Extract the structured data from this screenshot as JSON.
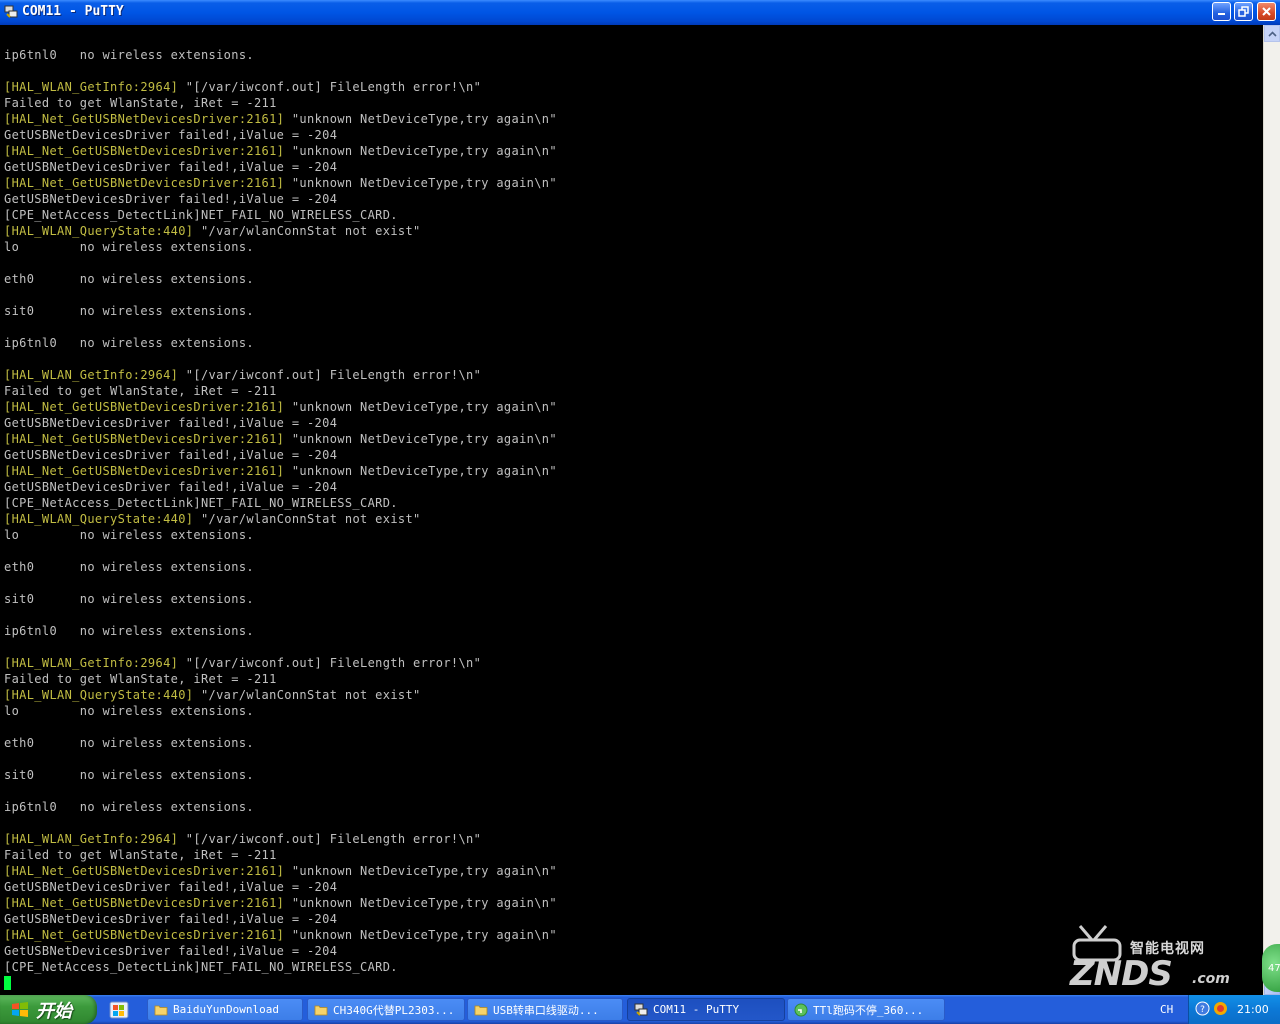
{
  "window": {
    "title": "COM11 - PuTTY"
  },
  "terminal": {
    "lines": [
      {
        "tag": "",
        "text": "ip6tnl0   no wireless extensions."
      },
      {
        "tag": "",
        "text": ""
      },
      {
        "tag": "[HAL_WLAN_GetInfo:2964]",
        "text": " \"[/var/iwconf.out] FileLength error!\\n\""
      },
      {
        "tag": "",
        "text": "Failed to get WlanState, iRet = -211"
      },
      {
        "tag": "[HAL_Net_GetUSBNetDevicesDriver:2161]",
        "text": " \"unknown NetDeviceType,try again\\n\""
      },
      {
        "tag": "",
        "text": "GetUSBNetDevicesDriver failed!,iValue = -204"
      },
      {
        "tag": "[HAL_Net_GetUSBNetDevicesDriver:2161]",
        "text": " \"unknown NetDeviceType,try again\\n\""
      },
      {
        "tag": "",
        "text": "GetUSBNetDevicesDriver failed!,iValue = -204"
      },
      {
        "tag": "[HAL_Net_GetUSBNetDevicesDriver:2161]",
        "text": " \"unknown NetDeviceType,try again\\n\""
      },
      {
        "tag": "",
        "text": "GetUSBNetDevicesDriver failed!,iValue = -204"
      },
      {
        "tag": "",
        "text": "[CPE_NetAccess_DetectLink]NET_FAIL_NO_WIRELESS_CARD."
      },
      {
        "tag": "[HAL_WLAN_QueryState:440]",
        "text": " \"/var/wlanConnStat not exist\""
      },
      {
        "tag": "",
        "text": "lo        no wireless extensions."
      },
      {
        "tag": "",
        "text": ""
      },
      {
        "tag": "",
        "text": "eth0      no wireless extensions."
      },
      {
        "tag": "",
        "text": ""
      },
      {
        "tag": "",
        "text": "sit0      no wireless extensions."
      },
      {
        "tag": "",
        "text": ""
      },
      {
        "tag": "",
        "text": "ip6tnl0   no wireless extensions."
      },
      {
        "tag": "",
        "text": ""
      },
      {
        "tag": "[HAL_WLAN_GetInfo:2964]",
        "text": " \"[/var/iwconf.out] FileLength error!\\n\""
      },
      {
        "tag": "",
        "text": "Failed to get WlanState, iRet = -211"
      },
      {
        "tag": "[HAL_Net_GetUSBNetDevicesDriver:2161]",
        "text": " \"unknown NetDeviceType,try again\\n\""
      },
      {
        "tag": "",
        "text": "GetUSBNetDevicesDriver failed!,iValue = -204"
      },
      {
        "tag": "[HAL_Net_GetUSBNetDevicesDriver:2161]",
        "text": " \"unknown NetDeviceType,try again\\n\""
      },
      {
        "tag": "",
        "text": "GetUSBNetDevicesDriver failed!,iValue = -204"
      },
      {
        "tag": "[HAL_Net_GetUSBNetDevicesDriver:2161]",
        "text": " \"unknown NetDeviceType,try again\\n\""
      },
      {
        "tag": "",
        "text": "GetUSBNetDevicesDriver failed!,iValue = -204"
      },
      {
        "tag": "",
        "text": "[CPE_NetAccess_DetectLink]NET_FAIL_NO_WIRELESS_CARD."
      },
      {
        "tag": "[HAL_WLAN_QueryState:440]",
        "text": " \"/var/wlanConnStat not exist\""
      },
      {
        "tag": "",
        "text": "lo        no wireless extensions."
      },
      {
        "tag": "",
        "text": ""
      },
      {
        "tag": "",
        "text": "eth0      no wireless extensions."
      },
      {
        "tag": "",
        "text": ""
      },
      {
        "tag": "",
        "text": "sit0      no wireless extensions."
      },
      {
        "tag": "",
        "text": ""
      },
      {
        "tag": "",
        "text": "ip6tnl0   no wireless extensions."
      },
      {
        "tag": "",
        "text": ""
      },
      {
        "tag": "[HAL_WLAN_GetInfo:2964]",
        "text": " \"[/var/iwconf.out] FileLength error!\\n\""
      },
      {
        "tag": "",
        "text": "Failed to get WlanState, iRet = -211"
      },
      {
        "tag": "[HAL_WLAN_QueryState:440]",
        "text": " \"/var/wlanConnStat not exist\""
      },
      {
        "tag": "",
        "text": "lo        no wireless extensions."
      },
      {
        "tag": "",
        "text": ""
      },
      {
        "tag": "",
        "text": "eth0      no wireless extensions."
      },
      {
        "tag": "",
        "text": ""
      },
      {
        "tag": "",
        "text": "sit0      no wireless extensions."
      },
      {
        "tag": "",
        "text": ""
      },
      {
        "tag": "",
        "text": "ip6tnl0   no wireless extensions."
      },
      {
        "tag": "",
        "text": ""
      },
      {
        "tag": "[HAL_WLAN_GetInfo:2964]",
        "text": " \"[/var/iwconf.out] FileLength error!\\n\""
      },
      {
        "tag": "",
        "text": "Failed to get WlanState, iRet = -211"
      },
      {
        "tag": "[HAL_Net_GetUSBNetDevicesDriver:2161]",
        "text": " \"unknown NetDeviceType,try again\\n\""
      },
      {
        "tag": "",
        "text": "GetUSBNetDevicesDriver failed!,iValue = -204"
      },
      {
        "tag": "[HAL_Net_GetUSBNetDevicesDriver:2161]",
        "text": " \"unknown NetDeviceType,try again\\n\""
      },
      {
        "tag": "",
        "text": "GetUSBNetDevicesDriver failed!,iValue = -204"
      },
      {
        "tag": "[HAL_Net_GetUSBNetDevicesDriver:2161]",
        "text": " \"unknown NetDeviceType,try again\\n\""
      },
      {
        "tag": "",
        "text": "GetUSBNetDevicesDriver failed!,iValue = -204"
      },
      {
        "tag": "",
        "text": "[CPE_NetAccess_DetectLink]NET_FAIL_NO_WIRELESS_CARD."
      }
    ]
  },
  "watermark": {
    "cn_text": "智能电视网",
    "brand": "ZNDS",
    "domain": ".com"
  },
  "badge": {
    "text": "47"
  },
  "taskbar": {
    "start_label": "开始",
    "buttons": [
      {
        "label": "BaiduYunDownload",
        "icon": "folder-icon",
        "active": false
      },
      {
        "label": "CH340G代替PL2303...",
        "icon": "folder-icon",
        "active": false
      },
      {
        "label": "USB转串口线驱动...",
        "icon": "folder-icon",
        "active": false
      },
      {
        "label": "COM11 - PuTTY",
        "icon": "putty-icon",
        "active": true
      },
      {
        "label": "TTl跑码不停_360...",
        "icon": "browser-icon",
        "active": false
      }
    ],
    "language": "CH",
    "clock": "21:00"
  },
  "colors": {
    "terminal_text": "#c0c0c0",
    "terminal_tag": "#c2bd43",
    "cursor": "#00ff40",
    "titlebar": "#0055e5",
    "taskbar": "#245edb"
  }
}
